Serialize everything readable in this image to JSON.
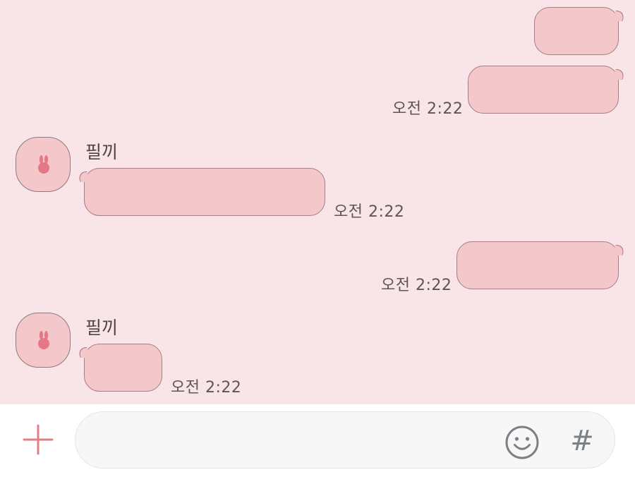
{
  "chat": {
    "contact_name": "필끼",
    "messages": [
      {
        "from": "me",
        "text": "",
        "time": ""
      },
      {
        "from": "me",
        "text": "",
        "time": "오전 2:22"
      },
      {
        "from": "them",
        "sender": "필끼",
        "text": "",
        "time": "오전 2:22"
      },
      {
        "from": "me",
        "text": "",
        "time": "오전 2:22"
      },
      {
        "from": "them",
        "sender": "필끼",
        "text": "",
        "time": "오전 2:22"
      }
    ]
  },
  "input": {
    "placeholder": "",
    "plus_icon": "plus-icon",
    "emoji_icon": "smiley-icon",
    "hash_icon": "hash-icon",
    "hash_glyph": "#"
  },
  "colors": {
    "chat_background": "#f9e4e7",
    "bubble_fill": "#f4c7cb",
    "bubble_border": "#a47e84",
    "accent_plus": "#e07f86",
    "icon_gray": "#7b7f86"
  }
}
